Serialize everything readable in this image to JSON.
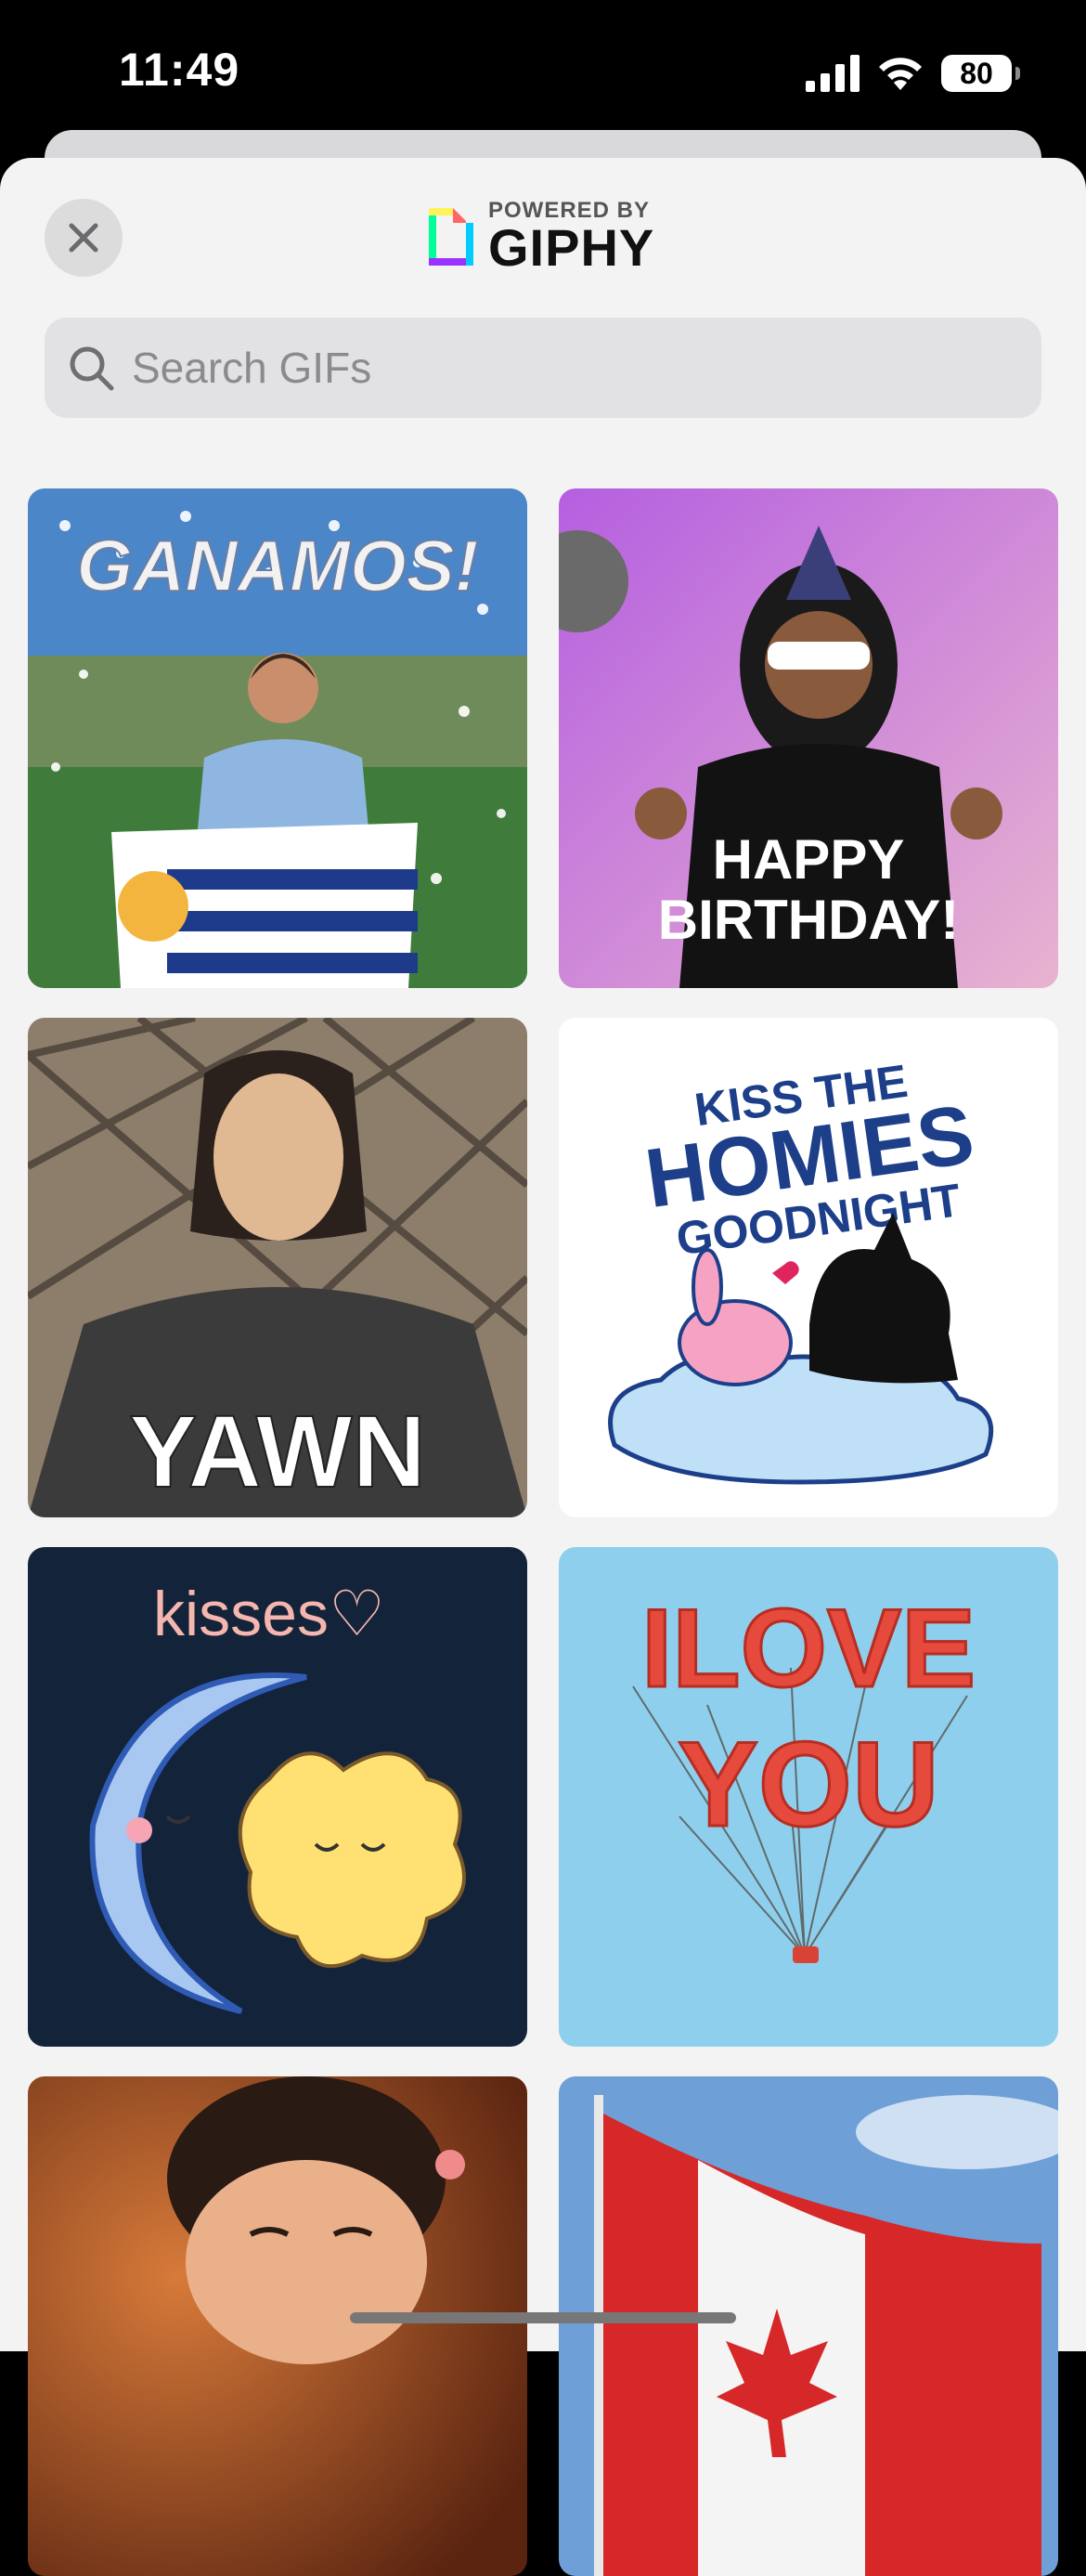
{
  "status_bar": {
    "time": "11:49",
    "battery_level": "80",
    "icons": [
      "cellular-signal-icon",
      "wifi-icon",
      "battery-icon"
    ]
  },
  "sheet": {
    "close_icon": "close-icon",
    "branding": {
      "powered_by": "POWERED BY",
      "name": "GIPHY",
      "logo_icon": "giphy-logo-icon"
    },
    "search": {
      "placeholder": "Search GIFs",
      "value": "",
      "icon": "search-icon"
    }
  },
  "gifs": [
    {
      "caption": "GANAMOS!",
      "colors": {
        "bg": "#4a86c8"
      }
    },
    {
      "caption": "HAPPY BIRTHDAY!",
      "colors": {
        "bg": "#c27ad6"
      }
    },
    {
      "caption": "YAWN",
      "colors": {
        "bg": "#8d7d6b"
      }
    },
    {
      "caption_lines": [
        "KISS THE",
        "HOMIES",
        "GOODNIGHT"
      ],
      "colors": {
        "bg": "#ffffff",
        "text": "#1d3f8a"
      }
    },
    {
      "caption": "kisses♡",
      "colors": {
        "bg": "#13233a",
        "text": "#f4b6ae"
      }
    },
    {
      "caption_lines": [
        "ILOVE",
        "YOU"
      ],
      "colors": {
        "bg": "#8fcfee",
        "text": "#e54a3c"
      }
    },
    {
      "caption": "",
      "colors": {
        "bg": "#a14a1f"
      }
    },
    {
      "caption": "",
      "colors": {
        "bg": "#6e9fd6"
      }
    }
  ],
  "colors": {
    "sheet_bg": "#f3f3f3",
    "search_bg": "#e2e2e4"
  }
}
